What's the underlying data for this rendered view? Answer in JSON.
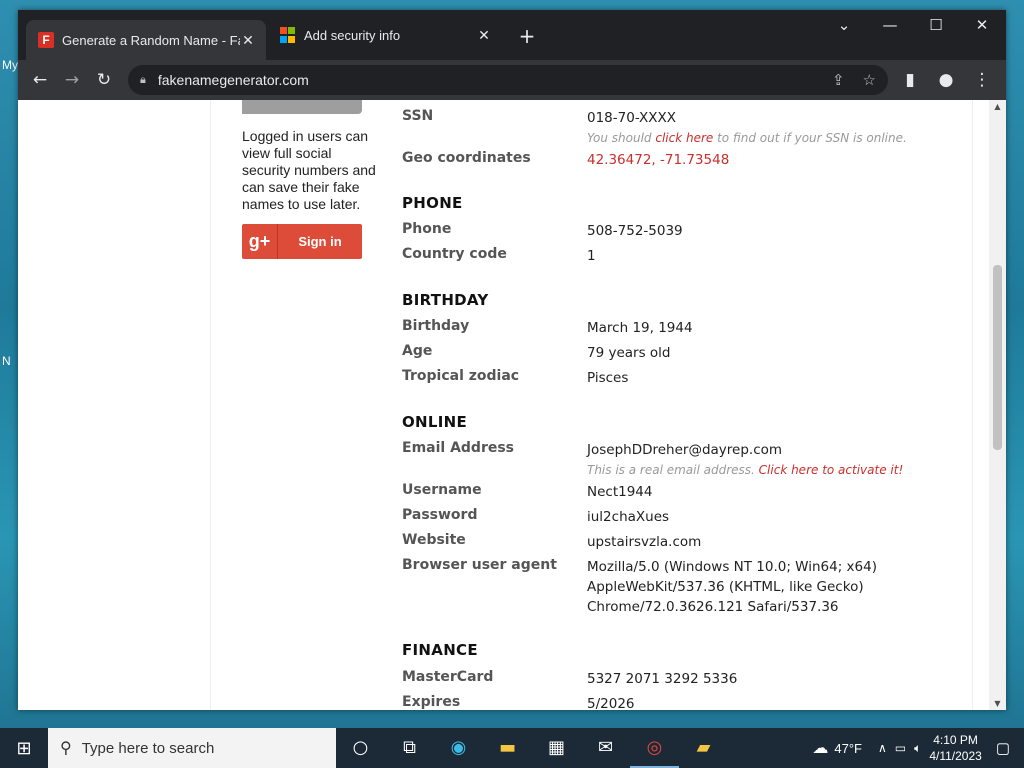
{
  "desktop": {
    "labels": [
      "My",
      "N"
    ]
  },
  "browser": {
    "tabs": [
      {
        "title": "Generate a Random Name - Fake",
        "favicon": "F",
        "active": true
      },
      {
        "title": "Add security info",
        "active": false
      }
    ],
    "url": "fakenamegenerator.com"
  },
  "sidebar": {
    "promo_text": "Logged in users can view full social security numbers and can save their fake names to use later.",
    "signin_icon": "g+",
    "signin_label": "Sign in"
  },
  "identity": {
    "ssn": {
      "label": "SSN",
      "value": "018-70-XXXX",
      "note_pre": "You should ",
      "note_link": "click here",
      "note_post": " to find out if your SSN is online."
    },
    "geo": {
      "label": "Geo coordinates",
      "value": "42.36472, -71.73548"
    },
    "phone_section": "PHONE",
    "phone": {
      "label": "Phone",
      "value": "508-752-5039"
    },
    "country_code": {
      "label": "Country code",
      "value": "1"
    },
    "birthday_section": "BIRTHDAY",
    "birthday": {
      "label": "Birthday",
      "value": "March 19, 1944"
    },
    "age": {
      "label": "Age",
      "value": "79 years old"
    },
    "zodiac": {
      "label": "Tropical zodiac",
      "value": "Pisces"
    },
    "online_section": "ONLINE",
    "email": {
      "label": "Email Address",
      "value": "JosephDDreher@dayrep.com",
      "note_pre": "This is a real email address. ",
      "note_link": "Click here to activate it!"
    },
    "username": {
      "label": "Username",
      "value": "Nect1944"
    },
    "password": {
      "label": "Password",
      "value": "iul2chaXues"
    },
    "website": {
      "label": "Website",
      "value": "upstairsvzla.com"
    },
    "ua": {
      "label": "Browser user agent",
      "value": "Mozilla/5.0 (Windows NT 10.0; Win64; x64) AppleWebKit/537.36 (KHTML, like Gecko) Chrome/72.0.3626.121 Safari/537.36"
    },
    "finance_section": "FINANCE",
    "mastercard": {
      "label": "MasterCard",
      "value": "5327 2071 3292 5336"
    },
    "expires": {
      "label": "Expires",
      "value": "5/2026"
    }
  },
  "taskbar": {
    "search_placeholder": "Type here to search",
    "weather": "47°F",
    "time": "4:10 PM",
    "date": "4/11/2023"
  },
  "colors": {
    "accent_red": "#c9302c",
    "google_red": "#dd4b39"
  }
}
